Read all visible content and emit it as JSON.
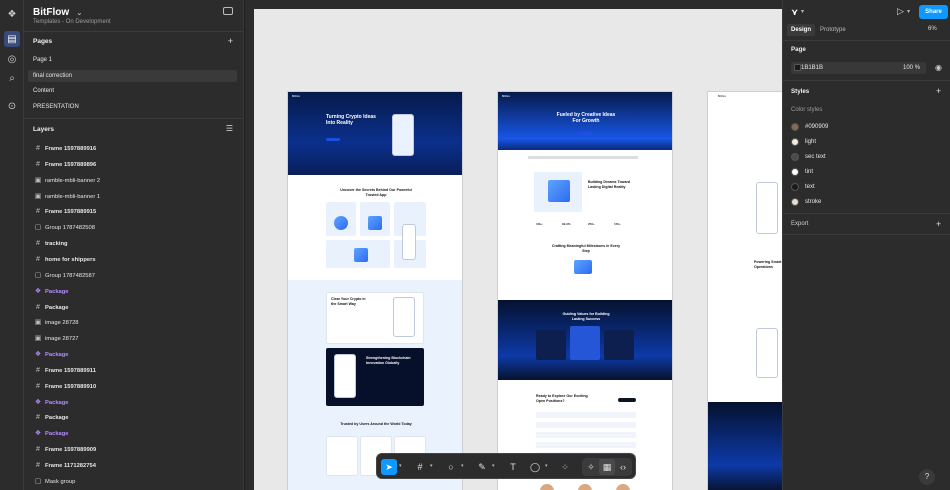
{
  "file": {
    "name": "BitFlow",
    "subtitle": "Templates - On Development"
  },
  "pages": {
    "title": "Pages",
    "items": [
      "Page 1",
      "final correction",
      "Content",
      "PRESENTATION"
    ],
    "selected_index": 1
  },
  "layers": {
    "title": "Layers",
    "items": [
      {
        "name": "Frame 1597889916",
        "icon": "frame-icon",
        "kind": "frame"
      },
      {
        "name": "Frame 1597889896",
        "icon": "frame-icon",
        "kind": "frame"
      },
      {
        "name": "ramble-mbli-banner 2",
        "icon": "image-icon",
        "kind": "image"
      },
      {
        "name": "ramble-mbli-banner 1",
        "icon": "image-icon",
        "kind": "image"
      },
      {
        "name": "Frame 1597889915",
        "icon": "frame-icon",
        "kind": "frame"
      },
      {
        "name": "Group 1787482508",
        "icon": "group-icon",
        "kind": "group"
      },
      {
        "name": "tracking",
        "icon": "frame-icon",
        "kind": "frame"
      },
      {
        "name": "home for shippers",
        "icon": "frame-icon",
        "kind": "frame"
      },
      {
        "name": "Group 1787482587",
        "icon": "group-icon",
        "kind": "group"
      },
      {
        "name": "Package",
        "icon": "component-icon",
        "kind": "component"
      },
      {
        "name": "Package",
        "icon": "frame-icon",
        "kind": "frame"
      },
      {
        "name": "image 28728",
        "icon": "image-icon",
        "kind": "image"
      },
      {
        "name": "image 28727",
        "icon": "image-icon",
        "kind": "image"
      },
      {
        "name": "Package",
        "icon": "component-icon",
        "kind": "component"
      },
      {
        "name": "Frame 1597889911",
        "icon": "frame-icon",
        "kind": "frame"
      },
      {
        "name": "Frame 1597889910",
        "icon": "frame-icon",
        "kind": "frame"
      },
      {
        "name": "Package",
        "icon": "component-icon",
        "kind": "component"
      },
      {
        "name": "Package",
        "icon": "frame-icon",
        "kind": "frame"
      },
      {
        "name": "Package",
        "icon": "component-icon",
        "kind": "component"
      },
      {
        "name": "Frame 1597889909",
        "icon": "frame-icon",
        "kind": "frame"
      },
      {
        "name": "Frame 1171282754",
        "icon": "frame-icon",
        "kind": "frame"
      },
      {
        "name": "Mask group",
        "icon": "group-icon",
        "kind": "group"
      }
    ]
  },
  "canvas": {
    "frame1": {
      "brand": "BitFlow",
      "hero_title": "Turning Crypto Ideas Into Reality",
      "section1_title": "Uncover the Secrets Behind Our Powerful Trusted App",
      "section2_title": "Clear Your Crypto in the Smart Way",
      "section3_title": "Strengthening Blockchain Innovation Globally",
      "section4_title": "Trusted by Users Around the World Today"
    },
    "frame2": {
      "brand": "BitFlow",
      "hero_title": "Fueled by Creative Ideas For Growth",
      "section1_title": "Building Dreams Toward Lasting Digital Reality",
      "section2_title": "Crafting Meaningful Milestones in Every Step",
      "section3_title": "Guiding Values for Building Lasting Success",
      "section4_title": "Ready to Explore Our Exciting Open Positions?",
      "stats": [
        "10k+",
        "99.9%",
        "250+",
        "150+"
      ]
    },
    "frame3": {
      "brand": "BitFlow",
      "section_title": "Powering Smart Digital Operations"
    }
  },
  "toolbar": {
    "tools": [
      "move-tool",
      "frame-tool",
      "shape-tool",
      "pen-tool",
      "text-tool",
      "comment-tool",
      "actions-tool"
    ],
    "modes": [
      "draw-mode",
      "design-mode",
      "dev-mode"
    ]
  },
  "right_panel": {
    "share_label": "Share",
    "tabs": [
      "Design",
      "Prototype"
    ],
    "active_tab": "Design",
    "zoom": "6%",
    "page": {
      "title": "Page",
      "hex": "1B1B1B",
      "opacity": "100",
      "pct_sign": "%"
    },
    "styles": {
      "title": "Styles",
      "color_styles_label": "Color styles",
      "items": [
        {
          "name": "#090909",
          "color": "#8b6a4a"
        },
        {
          "name": "light",
          "color": "#f3ead9"
        },
        {
          "name": "sec text",
          "color": "#4a4a4a"
        },
        {
          "name": "tint",
          "color": "#ffffff"
        },
        {
          "name": "text",
          "color": "#1a1a1a"
        },
        {
          "name": "stroke",
          "color": "#e9ddd3"
        }
      ]
    },
    "export": {
      "title": "Export"
    }
  },
  "colors": {
    "accent": "#0d99ff",
    "component": "#b38cff",
    "panel_bg": "#2c2c2c",
    "canvas_bg": "#e8e8e8"
  }
}
